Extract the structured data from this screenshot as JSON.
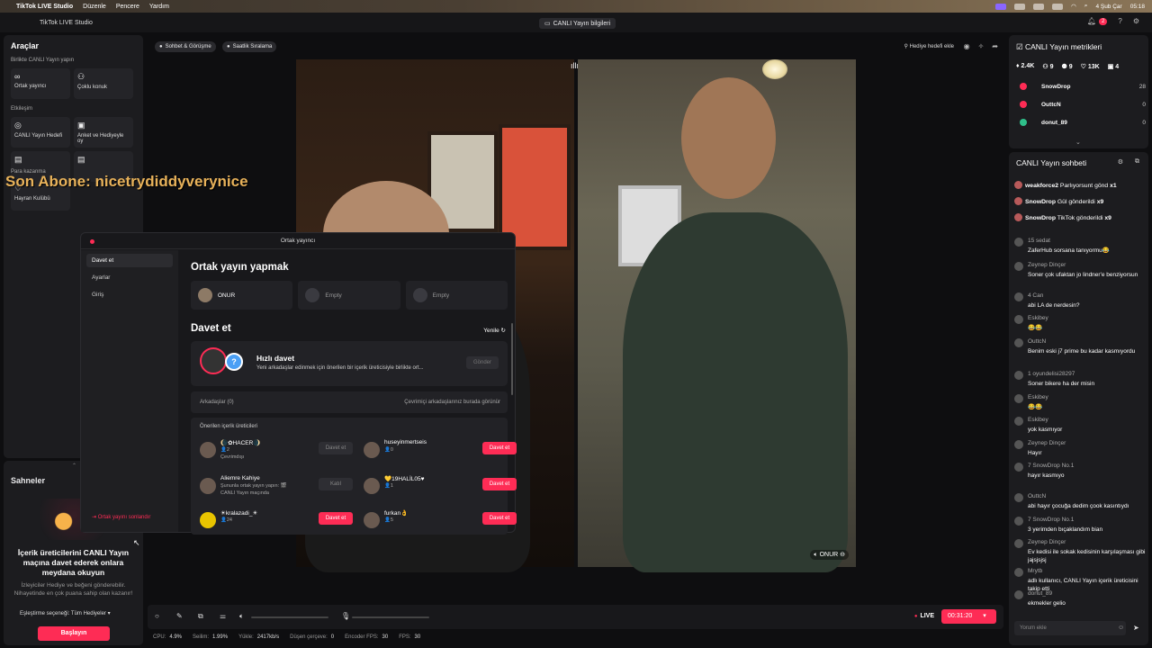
{
  "menubar": {
    "app": "TikTok LIVE Studio",
    "items": [
      "Düzenle",
      "Pencere",
      "Yardım"
    ],
    "date": "4 Şub Çar",
    "time": "05:18"
  },
  "window": {
    "title": "TikTok LIVE Studio",
    "live_info": "CANLI Yayın bilgileri",
    "notif_count": "2"
  },
  "left": {
    "title": "Araçlar",
    "sec1": "Birlikte CANLI Yayın yapın",
    "t1": "Ortak yayıncı",
    "t2": "Çoklu konuk",
    "sec2": "Etkileşim",
    "t3": "CANLI Yayın Hedefi",
    "t4": "Anket ve Hediyeyle oy",
    "sec3": "Para kazanma",
    "t5": "Hayran Kulübü",
    "overlay": "Son Abone: nicetrydiddyverynice"
  },
  "scenes": {
    "title": "Sahneler",
    "headline": "İçerik üreticilerini CANLI Yayın maçına davet ederek onlara meydana okuyun",
    "desc": "İzleyiciler Hediye ve beğeni gönderebilir. Nihayetinde en çok puana sahip olan kazanır!",
    "match": "Eşleştirme seçeneği: Tüm Hediyeler",
    "start": "Başlayın"
  },
  "center": {
    "chip1": "Sohbet & Görüşme",
    "chip2": "Saatlik Sıralama",
    "gift": "Hediye hedefi ekle",
    "guest": "ONUR"
  },
  "modal": {
    "title": "Ortak yayıncı",
    "side": [
      "Davet et",
      "Ayarlar",
      "Giriş"
    ],
    "end": "Ortak yayını sonlandır",
    "h1": "Ortak yayın yapmak",
    "slots": [
      "ONUR",
      "Empty",
      "Empty"
    ],
    "h2": "Davet et",
    "refresh": "Yenile",
    "quick_title": "Hızlı davet",
    "quick_desc": "Yeni arkadaşlar edinmek için önerilen bir içerik üreticisiyle birlikte ort...",
    "send": "Gönder",
    "friends": "Arkadaşlar (0)",
    "friends_r": "Çevrimiçi arkadaşlarınız burada görünür",
    "sugg": "Önerilen içerik üreticileri",
    "rows": [
      {
        "name": "🌘✿HACER🌒",
        "sub1": "👤2",
        "sub2": "Çevrimdışı",
        "btn": "Davet et",
        "gray": true
      },
      {
        "name": "huseyinmertseis",
        "sub1": "👤0",
        "sub2": "",
        "btn": "Davet et",
        "gray": false
      },
      {
        "name": "Aliemre Kahiye",
        "sub1": "Şununla ortak yayın yapın: 🎬",
        "sub2": "CANLI Yayın maçında",
        "btn": "Katıl",
        "gray": true
      },
      {
        "name": "💛19HALİL05♥",
        "sub1": "👤1",
        "sub2": "",
        "btn": "Davet et",
        "gray": false
      },
      {
        "name": "☀kralazadi_☀",
        "sub1": "👤24",
        "sub2": "",
        "btn": "Davet et",
        "gray": false
      },
      {
        "name": "furkan👌",
        "sub1": "👤5",
        "sub2": "",
        "btn": "Davet et",
        "gray": false
      }
    ]
  },
  "bottom": {
    "live": "LIVE",
    "timer": "00:31:20",
    "cpu": "4.9%",
    "sel": "1.99%",
    "up": "2417kb/s",
    "drop": "0",
    "enc": "30",
    "fps": "30",
    "l_cpu": "CPU:",
    "l_sel": "Seilim:",
    "l_up": "Yükle:",
    "l_drop": "Düşen çerçeve:",
    "l_enc": "Encoder FPS:",
    "l_fps": "FPS:"
  },
  "metrics": {
    "title": "CANLI Yayın metrikleri",
    "vals": [
      "2.4K",
      "9",
      "9",
      "13K",
      "4"
    ],
    "users": [
      {
        "name": "SnowDrop",
        "score": "28"
      },
      {
        "name": "OuttcN",
        "score": "0"
      },
      {
        "name": "donut_89",
        "score": "0"
      }
    ]
  },
  "chat": {
    "title": "CANLI Yayın sohbeti",
    "placeholder": "Yorum ekle",
    "gifts": [
      {
        "u": "weakforce2",
        "t": "Parlıyorsunt gönd",
        "x": "x1"
      },
      {
        "u": "SnowDrop",
        "t": "Gül gönderildi",
        "x": "x9"
      },
      {
        "u": "SnowDrop",
        "t": "TikTok gönderildi",
        "x": "x9"
      }
    ],
    "msgs": [
      {
        "u": "15 sedat",
        "t": "ZaferHub sorsana tanıyormu😂"
      },
      {
        "u": "Zeynep Dinçer",
        "t": "Soner çok ufaktan jo lindner'e benziyorsun"
      },
      {
        "u": "4 Can",
        "t": "abi LA de nerdesin?"
      },
      {
        "u": "Eskibey",
        "t": "😂😂"
      },
      {
        "u": "OuttcN",
        "t": "Benim eski j7 prime bu kadar kasmıyordu"
      },
      {
        "u": "1 oyundelisi28297",
        "t": "Soner bikere ha der misin"
      },
      {
        "u": "Eskibey",
        "t": "😂😂"
      },
      {
        "u": "Eskibey",
        "t": "yok kasmıyor"
      },
      {
        "u": "Zeynep Dinçer",
        "t": "Hayır"
      },
      {
        "u": "7 SnowDrop No.1",
        "t": "hayır kasmıyo"
      },
      {
        "u": "OuttcN",
        "t": "abi hayır çocuğa dedim çook kasıntıydı"
      },
      {
        "u": "7 SnowDrop No.1",
        "t": "3 yerimden bıçaklandım bian"
      },
      {
        "u": "Zeynep Dinçer",
        "t": "Ev kedisi ile sokak kedisinin karşılaşması gibi jajsjsjsj"
      },
      {
        "u": "Mrytb",
        "t": "adlı kullanıcı, CANLI Yayın içerik üreticisini takip etti"
      },
      {
        "u": "donut_89",
        "t": "ekmekler gelio"
      }
    ]
  }
}
